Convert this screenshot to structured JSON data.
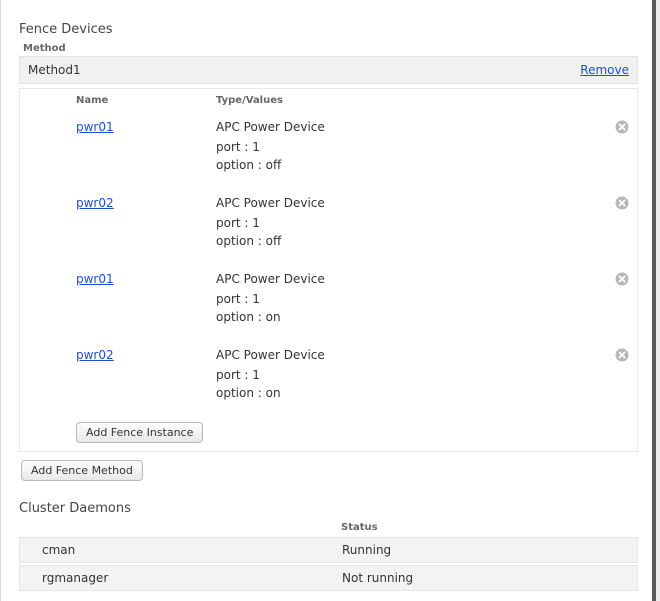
{
  "fence": {
    "title": "Fence Devices",
    "method_label": "Method",
    "method": {
      "name": "Method1",
      "remove_label": "Remove"
    },
    "columns": {
      "name": "Name",
      "type": "Type/Values"
    },
    "instances": [
      {
        "name": "pwr01",
        "type": "APC Power Device",
        "port_line": "port : 1",
        "option_line": "option : off"
      },
      {
        "name": "pwr02",
        "type": "APC Power Device",
        "port_line": "port : 1",
        "option_line": "option : off"
      },
      {
        "name": "pwr01",
        "type": "APC Power Device",
        "port_line": "port : 1",
        "option_line": "option : on"
      },
      {
        "name": "pwr02",
        "type": "APC Power Device",
        "port_line": "port : 1",
        "option_line": "option : on"
      }
    ],
    "add_instance_label": "Add Fence Instance",
    "add_method_label": "Add Fence Method"
  },
  "daemons": {
    "title": "Cluster Daemons",
    "status_label": "Status",
    "rows": [
      {
        "name": "cman",
        "status": "Running"
      },
      {
        "name": "rgmanager",
        "status": "Not running"
      }
    ]
  }
}
